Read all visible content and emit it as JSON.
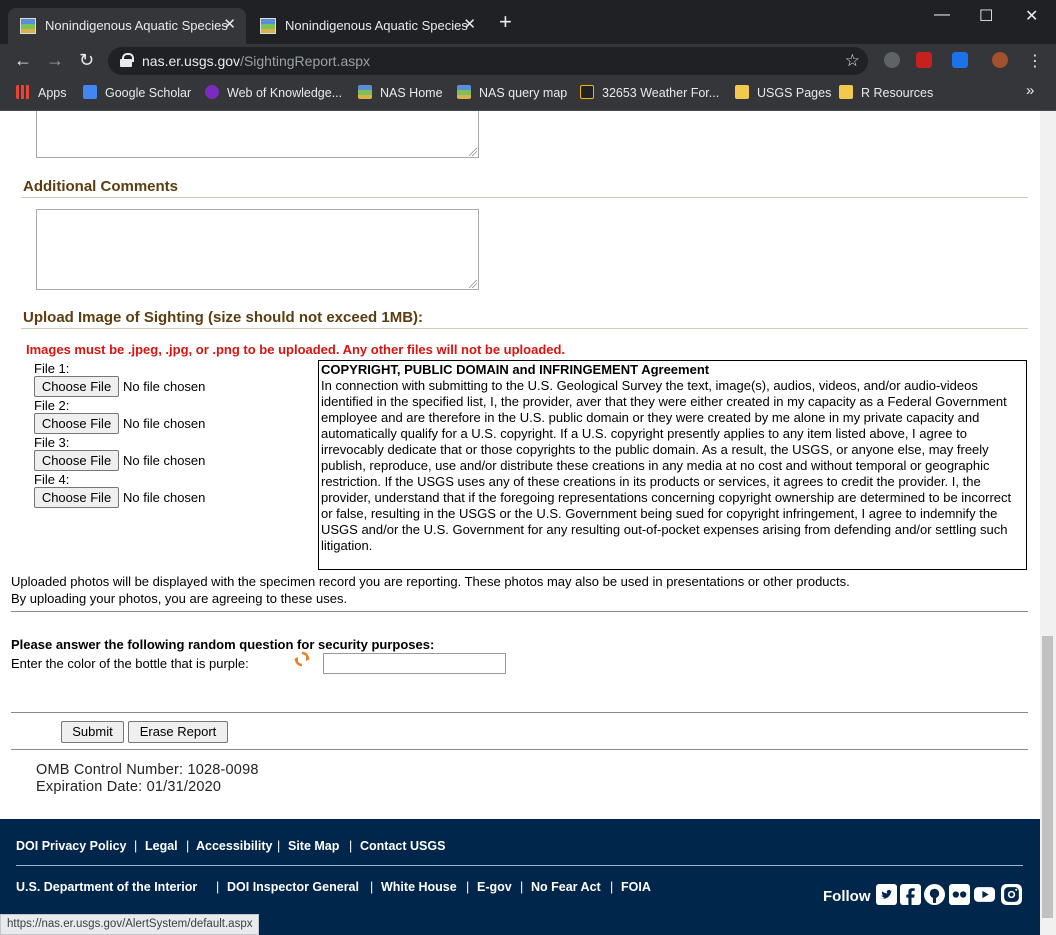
{
  "browser": {
    "tabs": [
      {
        "title": "Nonindigenous Aquatic Species",
        "active": true
      },
      {
        "title": "Nonindigenous Aquatic Species",
        "active": false
      }
    ],
    "new_tab": "+",
    "window_controls": {
      "minimize": "—",
      "maximize": "☐",
      "close": "✕"
    },
    "url_host": "nas.er.usgs.gov",
    "url_path": "/SightingReport.aspx",
    "bookmarks": [
      {
        "label": "Apps",
        "icon": "apps-grid-icon"
      },
      {
        "label": "Google Scholar",
        "icon": "google-scholar-icon"
      },
      {
        "label": "Web of Knowledge...",
        "icon": "web-of-knowledge-icon"
      },
      {
        "label": "NAS Home",
        "icon": "nas-icon"
      },
      {
        "label": "NAS query map",
        "icon": "nas-icon"
      },
      {
        "label": "32653 Weather For...",
        "icon": "wunderground-icon"
      },
      {
        "label": "USGS Pages",
        "icon": "folder-icon"
      },
      {
        "label": "R Resources",
        "icon": "folder-icon"
      }
    ],
    "bookmarks_overflow": "»",
    "status_url": "https://nas.er.usgs.gov/AlertSystem/default.aspx"
  },
  "form": {
    "additional_comments_heading": "Additional Comments",
    "upload_heading": "Upload Image of Sighting (size should not exceed 1MB):",
    "upload_warning": "Images must be .jpeg, .jpg, or .png to be uploaded. Any other files will not be uploaded.",
    "files": [
      {
        "label": "File 1:",
        "button": "Choose File",
        "status": "No file chosen"
      },
      {
        "label": "File 2:",
        "button": "Choose File",
        "status": "No file chosen"
      },
      {
        "label": "File 3:",
        "button": "Choose File",
        "status": "No file chosen"
      },
      {
        "label": "File 4:",
        "button": "Choose File",
        "status": "No file chosen"
      }
    ],
    "agreement_title": "COPYRIGHT, PUBLIC DOMAIN and INFRINGEMENT Agreement",
    "agreement_text": "In connection with submitting to the U.S. Geological Survey the text, image(s), audios, videos, and/or audio-videos identified in the specified list, I, the provider, aver that they were either created in my capacity as a Federal Government employee and are therefore in the U.S. public domain or they were created by me alone in my private capacity and automatically qualify for a U.S. copyright. If a U.S. copyright presently applies to any item listed above, I agree to irrevocably dedicate that or those copyrights to the public domain. As a result, the USGS, or anyone else, may freely publish, reproduce, use and/or distribute these creations in any media at no cost and without temporal or geographic restriction. If the USGS uses any of these creations in its products or services, it agrees to credit the provider. I, the provider, understand that if the foregoing representations concerning copyright ownership are determined to be incorrect or false, resulting in the USGS or the U.S. Government being sued for copyright infringement, I agree to indemnify the USGS and/or the U.S. Government for any resulting out-of-pocket expenses arising from defending and/or settling such litigation.",
    "photo_note_1": "Uploaded photos will be displayed with the specimen record you are reporting. These photos may also be used in presentations or other products.",
    "photo_note_2": "By uploading your photos, you are agreeing to these uses.",
    "security_heading": "Please answer the following random question for security purposes:",
    "security_question": "Enter the color of the bottle that is purple:",
    "security_answer": "",
    "submit_label": "Submit",
    "erase_label": "Erase Report",
    "omb_number": "OMB Control Number: 1028-0098",
    "expiration": "Expiration Date: 01/31/2020"
  },
  "footer": {
    "row1": [
      "DOI Privacy Policy",
      "Legal",
      "Accessibility",
      "Site Map",
      "Contact USGS"
    ],
    "row2": [
      "U.S. Department of the Interior",
      "DOI Inspector General",
      "White House",
      "E-gov",
      "No Fear Act",
      "FOIA"
    ],
    "separator": "|",
    "follow_label": "Follow",
    "social": [
      "twitter-icon",
      "facebook-icon",
      "github-icon",
      "flickr-icon",
      "youtube-icon",
      "instagram-icon"
    ]
  }
}
